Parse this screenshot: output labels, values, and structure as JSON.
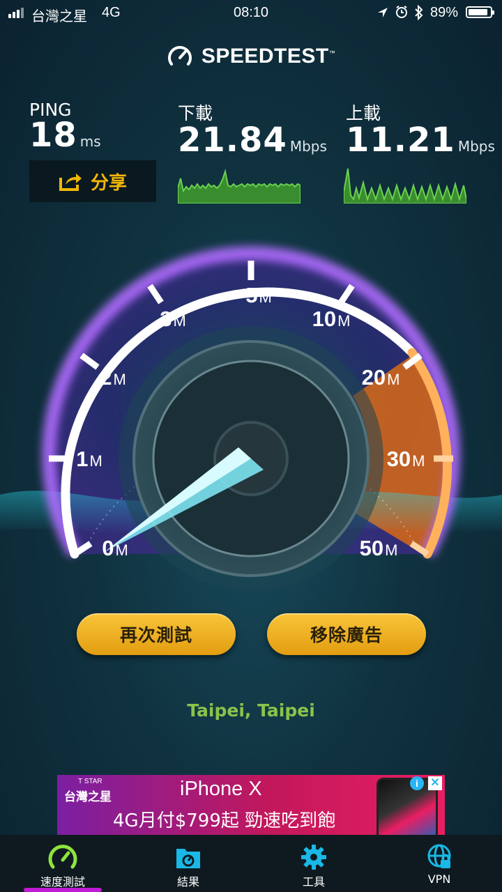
{
  "status_bar": {
    "carrier": "台灣之星",
    "network": "4G",
    "time": "08:10",
    "battery_percent": "89%",
    "battery_level": 0.89
  },
  "header": {
    "title": "SPEEDTEST",
    "trademark": "™"
  },
  "metrics": {
    "ping": {
      "label": "PING",
      "value": "18",
      "unit": "ms"
    },
    "download": {
      "label": "下載",
      "value": "21.84",
      "unit": "Mbps"
    },
    "upload": {
      "label": "上載",
      "value": "11.21",
      "unit": "Mbps"
    }
  },
  "share": {
    "label": "分享"
  },
  "gauge": {
    "ticks": [
      {
        "num": "0",
        "unit": "M"
      },
      {
        "num": "1",
        "unit": "M"
      },
      {
        "num": "2",
        "unit": "M"
      },
      {
        "num": "3",
        "unit": "M"
      },
      {
        "num": "5",
        "unit": "M"
      },
      {
        "num": "10",
        "unit": "M"
      },
      {
        "num": "20",
        "unit": "M"
      },
      {
        "num": "30",
        "unit": "M"
      },
      {
        "num": "50",
        "unit": "M"
      }
    ],
    "colors": {
      "arc": "#ffffff",
      "glow": "#b06cff",
      "active": "#f28a1e",
      "needle": "#7de3f0"
    }
  },
  "buttons": {
    "retest": "再次測試",
    "remove_ads": "移除廣告"
  },
  "location": "Taipei, Taipei",
  "ad": {
    "brand_small": "T STAR",
    "brand": "台灣之星",
    "title": " iPhone X",
    "promo": "4G月付$799起  勁速吃到飽",
    "info": "i",
    "close": "✕"
  },
  "tabs": [
    {
      "label": "速度測試",
      "icon": "speedometer-icon",
      "active": true
    },
    {
      "label": "結果",
      "icon": "results-icon",
      "active": false
    },
    {
      "label": "工具",
      "icon": "gear-icon",
      "active": false
    },
    {
      "label": "VPN",
      "icon": "vpn-globe-icon",
      "active": false
    }
  ],
  "accent": "#f2b705"
}
